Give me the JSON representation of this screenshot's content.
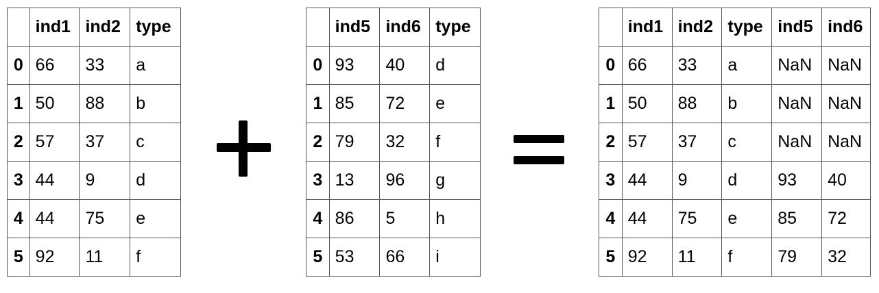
{
  "tables": {
    "left": {
      "columns": [
        "",
        "ind1",
        "ind2",
        "type"
      ],
      "rows": [
        [
          "0",
          "66",
          "33",
          "a"
        ],
        [
          "1",
          "50",
          "88",
          "b"
        ],
        [
          "2",
          "57",
          "37",
          "c"
        ],
        [
          "3",
          "44",
          "9",
          "d"
        ],
        [
          "4",
          "44",
          "75",
          "e"
        ],
        [
          "5",
          "92",
          "11",
          "f"
        ]
      ]
    },
    "middle": {
      "columns": [
        "",
        "ind5",
        "ind6",
        "type"
      ],
      "rows": [
        [
          "0",
          "93",
          "40",
          "d"
        ],
        [
          "1",
          "85",
          "72",
          "e"
        ],
        [
          "2",
          "79",
          "32",
          "f"
        ],
        [
          "3",
          "13",
          "96",
          "g"
        ],
        [
          "4",
          "86",
          "5",
          "h"
        ],
        [
          "5",
          "53",
          "66",
          "i"
        ]
      ]
    },
    "right": {
      "columns": [
        "",
        "ind1",
        "ind2",
        "type",
        "ind5",
        "ind6"
      ],
      "rows": [
        [
          "0",
          "66",
          "33",
          "a",
          "NaN",
          "NaN"
        ],
        [
          "1",
          "50",
          "88",
          "b",
          "NaN",
          "NaN"
        ],
        [
          "2",
          "57",
          "37",
          "c",
          "NaN",
          "NaN"
        ],
        [
          "3",
          "44",
          "9",
          "d",
          "93",
          "40"
        ],
        [
          "4",
          "44",
          "75",
          "e",
          "85",
          "72"
        ],
        [
          "5",
          "92",
          "11",
          "f",
          "79",
          "32"
        ]
      ]
    }
  },
  "operators": {
    "plus_icon": "plus-sign",
    "equals_icon": "equals-sign"
  }
}
